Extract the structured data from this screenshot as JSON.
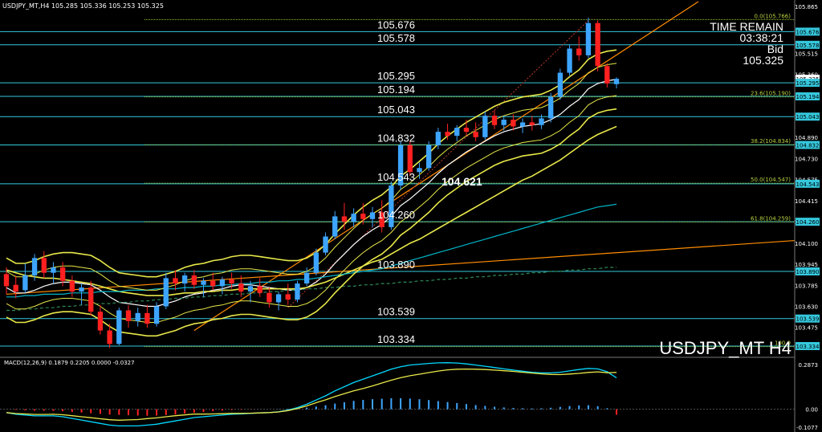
{
  "header": {
    "title": "USDJPY_MT,H4  105.285 105.336 105.253 105.325"
  },
  "info_box": {
    "time_remain_label": "TIME REMAIN",
    "time_remain_value": "03:38:21",
    "bid_label": "Bid",
    "bid_value": "105.325"
  },
  "symbol_label": "USDJPY_MT H4",
  "mid_label": "104.621",
  "colors": {
    "background": "#000000",
    "bull": "#3da5ff",
    "bear": "#ff2020",
    "level_line": "#35c8dd",
    "bollinger": "#e8e84a",
    "fib": "#9acd32",
    "trendline": "#ff8c00",
    "ma_cyan": "#00b4c8",
    "macd_main": "#00d8ff",
    "macd_signal": "#e8e84a"
  },
  "chart_data": [
    {
      "type": "candlestick",
      "title": "USDJPY_MT,H4",
      "ylim": [
        103.28,
        105.84
      ],
      "y_ticks": [
        "105.865",
        "105.676",
        "105.578",
        "105.515",
        "105.360",
        "105.285",
        "105.295",
        "105.194",
        "105.045",
        "105.043",
        "104.890",
        "104.832",
        "104.730",
        "104.575",
        "104.543",
        "104.415",
        "104.260",
        "104.100",
        "103.945",
        "103.890",
        "103.785",
        "103.630",
        "103.539",
        "103.475",
        "103.334"
      ],
      "levels": [
        "105.676",
        "105.578",
        "105.295",
        "105.194",
        "105.043",
        "104.832",
        "104.543",
        "104.260",
        "103.890",
        "103.539",
        "103.334"
      ],
      "price_tags": [
        "105.676",
        "105.578",
        "105.325",
        "105.295",
        "105.194",
        "105.043",
        "104.832",
        "104.543",
        "104.260",
        "103.890",
        "103.539",
        "103.334"
      ],
      "fibonacci": [
        {
          "label": "0.0(105.766)",
          "value": 105.766
        },
        {
          "label": "23.6(105.190)",
          "value": 105.19
        },
        {
          "label": "38.2(104.834)",
          "value": 104.834
        },
        {
          "label": "50.0(104.547)",
          "value": 104.547
        },
        {
          "label": "61.8(104.259)",
          "value": 104.259
        },
        {
          "label": "100.0",
          "value": 103.33
        }
      ],
      "candles": [
        [
          103.87,
          103.92,
          103.72,
          103.78
        ],
        [
          103.79,
          103.86,
          103.69,
          103.74
        ],
        [
          103.75,
          103.95,
          103.73,
          103.86
        ],
        [
          103.86,
          104.02,
          103.82,
          103.99
        ],
        [
          103.99,
          104.04,
          103.84,
          103.88
        ],
        [
          103.88,
          103.96,
          103.8,
          103.92
        ],
        [
          103.92,
          103.96,
          103.78,
          103.82
        ],
        [
          103.82,
          103.86,
          103.7,
          103.74
        ],
        [
          103.74,
          103.8,
          103.64,
          103.77
        ],
        [
          103.77,
          103.82,
          103.56,
          103.59
        ],
        [
          103.59,
          103.64,
          103.42,
          103.45
        ],
        [
          103.45,
          103.5,
          103.32,
          103.35
        ],
        [
          103.35,
          103.62,
          103.34,
          103.6
        ],
        [
          103.6,
          103.64,
          103.47,
          103.52
        ],
        [
          103.52,
          103.62,
          103.48,
          103.58
        ],
        [
          103.58,
          103.64,
          103.47,
          103.5
        ],
        [
          103.5,
          103.66,
          103.48,
          103.63
        ],
        [
          103.63,
          103.88,
          103.61,
          103.84
        ],
        [
          103.84,
          103.9,
          103.75,
          103.8
        ],
        [
          103.8,
          103.88,
          103.74,
          103.86
        ],
        [
          103.86,
          103.9,
          103.76,
          103.79
        ],
        [
          103.79,
          103.84,
          103.7,
          103.82
        ],
        [
          103.82,
          103.88,
          103.75,
          103.78
        ],
        [
          103.78,
          103.85,
          103.72,
          103.83
        ],
        [
          103.83,
          103.88,
          103.76,
          103.8
        ],
        [
          103.8,
          103.86,
          103.7,
          103.74
        ],
        [
          103.74,
          103.82,
          103.66,
          103.78
        ],
        [
          103.78,
          103.84,
          103.7,
          103.73
        ],
        [
          103.73,
          103.77,
          103.62,
          103.66
        ],
        [
          103.66,
          103.74,
          103.6,
          103.72
        ],
        [
          103.72,
          103.8,
          103.64,
          103.68
        ],
        [
          103.68,
          103.82,
          103.66,
          103.8
        ],
        [
          103.8,
          103.92,
          103.78,
          103.88
        ],
        [
          103.88,
          104.06,
          103.86,
          104.03
        ],
        [
          104.03,
          104.18,
          104.01,
          104.15
        ],
        [
          104.15,
          104.34,
          104.13,
          104.3
        ],
        [
          104.3,
          104.4,
          104.2,
          104.26
        ],
        [
          104.26,
          104.36,
          104.22,
          104.32
        ],
        [
          104.32,
          104.4,
          104.24,
          104.28
        ],
        [
          104.28,
          104.37,
          104.22,
          104.33
        ],
        [
          104.33,
          104.42,
          104.18,
          104.22
        ],
        [
          104.22,
          104.56,
          104.2,
          104.53
        ],
        [
          104.53,
          104.86,
          104.5,
          104.83
        ],
        [
          104.83,
          104.86,
          104.6,
          104.63
        ],
        [
          104.63,
          104.7,
          104.58,
          104.66
        ],
        [
          104.66,
          104.86,
          104.64,
          104.83
        ],
        [
          104.83,
          104.96,
          104.8,
          104.93
        ],
        [
          104.93,
          104.99,
          104.87,
          104.9
        ],
        [
          104.9,
          104.98,
          104.86,
          104.96
        ],
        [
          104.96,
          105.02,
          104.9,
          104.93
        ],
        [
          104.93,
          105.0,
          104.86,
          104.89
        ],
        [
          104.89,
          105.08,
          104.87,
          105.05
        ],
        [
          105.05,
          105.09,
          104.95,
          104.98
        ],
        [
          104.98,
          105.05,
          104.94,
          105.02
        ],
        [
          105.02,
          105.06,
          104.94,
          104.97
        ],
        [
          104.97,
          105.03,
          104.92,
          105.0
        ],
        [
          105.0,
          105.05,
          104.94,
          104.98
        ],
        [
          104.98,
          105.06,
          104.95,
          105.03
        ],
        [
          105.03,
          105.22,
          105.0,
          105.19
        ],
        [
          105.19,
          105.4,
          105.17,
          105.37
        ],
        [
          105.37,
          105.58,
          105.35,
          105.55
        ],
        [
          105.55,
          105.64,
          105.46,
          105.5
        ],
        [
          105.5,
          105.78,
          105.48,
          105.74
        ],
        [
          105.74,
          105.76,
          105.38,
          105.42
        ],
        [
          105.42,
          105.44,
          105.26,
          105.29
        ],
        [
          105.285,
          105.336,
          105.253,
          105.325
        ]
      ],
      "overlays": [
        {
          "name": "",
          "values": [
            103.77,
            103.73,
            103.73,
            103.75,
            103.78,
            103.8,
            103.81,
            103.81,
            103.8,
            103.79,
            103.75,
            103.7,
            103.66,
            103.65,
            103.64,
            103.63,
            103.63,
            103.65,
            103.67,
            103.7,
            103.72,
            103.73,
            103.75,
            103.76,
            103.78,
            103.79,
            103.79,
            103.78,
            103.77,
            103.76,
            103.75,
            103.75,
            103.77,
            103.81,
            103.87,
            103.95,
            104.02,
            104.09,
            104.15,
            104.2,
            104.24,
            104.3,
            104.38,
            104.43,
            104.49,
            104.55,
            104.62,
            104.68,
            104.73,
            104.78,
            104.82,
            104.86,
            104.9,
            104.93,
            104.95,
            104.97,
            104.98,
            104.99,
            105.02,
            105.06,
            105.12,
            105.17,
            105.25,
            105.29,
            105.31,
            105.32
          ]
        },
        {
          "name": "",
          "values": [
            103.9,
            103.88,
            103.86,
            103.85,
            103.84,
            103.84,
            103.83,
            103.82,
            103.81,
            103.8,
            103.78,
            103.76,
            103.74,
            103.73,
            103.72,
            103.71,
            103.71,
            103.71,
            103.72,
            103.73,
            103.73,
            103.74,
            103.74,
            103.75,
            103.75,
            103.76,
            103.76,
            103.76,
            103.76,
            103.76,
            103.76,
            103.76,
            103.77,
            103.79,
            103.81,
            103.84,
            103.87,
            103.9,
            103.93,
            103.96,
            103.98,
            104.02,
            104.06,
            104.1,
            104.13,
            104.17,
            104.21,
            104.25,
            104.29,
            104.33,
            104.37,
            104.41,
            104.45,
            104.49,
            104.53,
            104.57,
            104.6,
            104.64,
            104.68,
            104.72,
            104.77,
            104.82,
            104.87,
            104.91,
            104.94,
            104.97
          ]
        },
        {
          "name": "",
          "values": [
            103.7,
            103.7,
            103.71,
            103.71,
            103.72,
            103.72,
            103.72,
            103.73,
            103.73,
            103.73,
            103.74,
            103.74,
            103.74,
            103.75,
            103.75,
            103.75,
            103.76,
            103.76,
            103.76,
            103.77,
            103.77,
            103.78,
            103.78,
            103.79,
            103.79,
            103.8,
            103.8,
            103.81,
            103.81,
            103.82,
            103.82,
            103.83,
            103.83,
            103.84,
            103.85,
            103.86,
            103.87,
            103.88,
            103.89,
            103.9,
            103.91,
            103.93,
            103.95,
            103.97,
            103.99,
            104.01,
            104.03,
            104.05,
            104.07,
            104.09,
            104.11,
            104.13,
            104.15,
            104.17,
            104.19,
            104.21,
            104.23,
            104.25,
            104.27,
            104.29,
            104.31,
            104.33,
            104.35,
            104.37,
            104.38,
            104.39
          ]
        },
        {
          "name": "",
          "values": [
            103.6,
            103.6,
            103.61,
            103.61,
            103.62,
            103.62,
            103.63,
            103.63,
            103.64,
            103.64,
            103.65,
            103.65,
            103.66,
            103.66,
            103.67,
            103.67,
            103.68,
            103.68,
            103.69,
            103.69,
            103.7,
            103.7,
            103.71,
            103.71,
            103.72,
            103.72,
            103.73,
            103.73,
            103.74,
            103.74,
            103.75,
            103.75,
            103.76,
            103.76,
            103.77,
            103.77,
            103.78,
            103.78,
            103.79,
            103.79,
            103.8,
            103.8,
            103.81,
            103.81,
            103.82,
            103.82,
            103.83,
            103.83,
            103.84,
            103.84,
            103.85,
            103.85,
            103.86,
            103.86,
            103.87,
            103.87,
            103.88,
            103.88,
            103.89,
            103.89,
            103.9,
            103.9,
            103.91,
            103.91,
            103.92,
            103.92
          ]
        }
      ]
    },
    {
      "type": "macd",
      "title": "MACD(12,26,9) 0.1879 0.2205 0.0000 -0.0327",
      "ylim": [
        -0.1077,
        0.2873
      ],
      "y_ticks": [
        "0.2873",
        "0.00",
        "-0.1077"
      ],
      "histogram": [
        0.0,
        -0.004,
        -0.007,
        -0.009,
        -0.009,
        -0.01,
        -0.012,
        -0.016,
        -0.02,
        -0.024,
        -0.028,
        -0.032,
        -0.034,
        -0.036,
        -0.038,
        -0.039,
        -0.038,
        -0.035,
        -0.031,
        -0.026,
        -0.021,
        -0.016,
        -0.012,
        -0.008,
        -0.005,
        -0.003,
        -0.001,
        0.0,
        0.0,
        0.001,
        0.003,
        0.006,
        0.01,
        0.016,
        0.024,
        0.034,
        0.042,
        0.05,
        0.056,
        0.06,
        0.063,
        0.066,
        0.066,
        0.064,
        0.06,
        0.055,
        0.049,
        0.043,
        0.037,
        0.031,
        0.025,
        0.02,
        0.015,
        0.011,
        0.008,
        0.006,
        0.005,
        0.006,
        0.009,
        0.014,
        0.019,
        0.023,
        0.024,
        0.018,
        0.006,
        -0.033
      ],
      "main": [
        -0.02,
        -0.03,
        -0.035,
        -0.04,
        -0.04,
        -0.04,
        -0.045,
        -0.055,
        -0.065,
        -0.075,
        -0.085,
        -0.095,
        -0.1,
        -0.1,
        -0.1,
        -0.095,
        -0.09,
        -0.08,
        -0.07,
        -0.06,
        -0.05,
        -0.045,
        -0.04,
        -0.035,
        -0.03,
        -0.028,
        -0.025,
        -0.022,
        -0.02,
        -0.015,
        -0.005,
        0.01,
        0.03,
        0.055,
        0.08,
        0.11,
        0.135,
        0.16,
        0.18,
        0.2,
        0.22,
        0.24,
        0.255,
        0.265,
        0.27,
        0.275,
        0.278,
        0.279,
        0.277,
        0.272,
        0.265,
        0.258,
        0.25,
        0.242,
        0.235,
        0.228,
        0.222,
        0.218,
        0.218,
        0.222,
        0.23,
        0.238,
        0.245,
        0.242,
        0.225,
        0.188
      ],
      "signal": [
        -0.02,
        -0.026,
        -0.028,
        -0.031,
        -0.031,
        -0.03,
        -0.033,
        -0.039,
        -0.045,
        -0.051,
        -0.057,
        -0.063,
        -0.066,
        -0.064,
        -0.062,
        -0.056,
        -0.052,
        -0.045,
        -0.039,
        -0.034,
        -0.029,
        -0.029,
        -0.028,
        -0.027,
        -0.025,
        -0.025,
        -0.024,
        -0.022,
        -0.02,
        -0.016,
        -0.008,
        0.004,
        0.02,
        0.039,
        0.056,
        0.076,
        0.093,
        0.11,
        0.124,
        0.14,
        0.157,
        0.174,
        0.189,
        0.201,
        0.21,
        0.22,
        0.229,
        0.236,
        0.24,
        0.241,
        0.24,
        0.238,
        0.235,
        0.231,
        0.227,
        0.222,
        0.217,
        0.212,
        0.209,
        0.208,
        0.211,
        0.215,
        0.221,
        0.224,
        0.219,
        0.221
      ]
    }
  ]
}
